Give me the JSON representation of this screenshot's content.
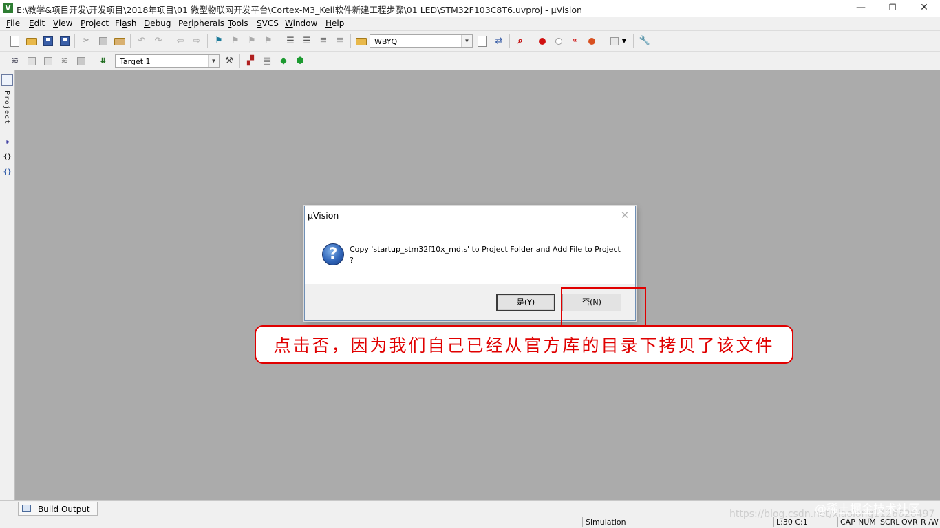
{
  "window": {
    "title": "E:\\教学&项目开发\\开发项目\\2018年项目\\01 微型物联网开发平台\\Cortex-M3_Keil软件新建工程步骤\\01 LED\\STM32F103C8T6.uvproj - µVision",
    "app_icon_letter": "V",
    "controls": {
      "minimize": "—",
      "restore": "❐",
      "close": "✕"
    }
  },
  "menu": {
    "items": [
      {
        "pre": "",
        "u": "F",
        "post": "ile"
      },
      {
        "pre": "",
        "u": "E",
        "post": "dit"
      },
      {
        "pre": "",
        "u": "V",
        "post": "iew"
      },
      {
        "pre": "",
        "u": "P",
        "post": "roject"
      },
      {
        "pre": "Fl",
        "u": "a",
        "post": "sh"
      },
      {
        "pre": "",
        "u": "D",
        "post": "ebug"
      },
      {
        "pre": "Pe",
        "u": "r",
        "post": "ipherals"
      },
      {
        "pre": "",
        "u": "T",
        "post": "ools"
      },
      {
        "pre": "",
        "u": "S",
        "post": "VCS"
      },
      {
        "pre": "",
        "u": "W",
        "post": "indow"
      },
      {
        "pre": "",
        "u": "H",
        "post": "elp"
      }
    ]
  },
  "toolbar1": {
    "find_combo_value": "WBYQ",
    "icons": [
      "new-file-icon",
      "open-folder-icon",
      "save-icon",
      "save-all-icon",
      "cut-icon",
      "copy-icon",
      "paste-icon",
      "undo-icon",
      "redo-icon",
      "nav-back-icon",
      "nav-forward-icon",
      "bookmark-icon",
      "prev-bookmark-icon",
      "next-bookmark-icon",
      "clear-bookmarks-icon",
      "indent-icon",
      "unindent-icon",
      "comment-icon",
      "uncomment-icon",
      "find-in-files-icon",
      "find-icon",
      "incremental-find-icon",
      "debug-session-icon",
      "breakpoint-icon",
      "disable-breakpoint-icon",
      "disable-all-breakpoints-icon",
      "kill-breakpoints-icon",
      "window-layout-icon",
      "configure-icon"
    ]
  },
  "toolbar2": {
    "target_combo_value": "Target 1",
    "icons": [
      "translate-icon",
      "build-icon",
      "rebuild-icon",
      "batch-build-icon",
      "stop-build-icon",
      "load-icon",
      "target-options-icon",
      "manage-components-icon",
      "pack-installer-icon",
      "select-packs-icon",
      "rte-icon"
    ]
  },
  "side_panel": {
    "project_label": "Project",
    "buttons": [
      "books-icon",
      "functions-icon",
      "templates-icon"
    ],
    "functions_glyph": "{}",
    "templates_glyph": "{}"
  },
  "bottom": {
    "build_output_tab": "Build Output"
  },
  "status": {
    "mode": "Simulation",
    "cursor": "L:30 C:1",
    "caps": "CAP",
    "num": "NUM",
    "scrl": "SCRL",
    "ovr": "OVR",
    "rw": "R /W"
  },
  "dialog": {
    "title": "µVision",
    "close_glyph": "✕",
    "icon_glyph": "?",
    "message_line1": "Copy 'startup_stm32f10x_md.s' to Project Folder and Add File to Project",
    "message_line2": "?",
    "yes_label": "是(Y)",
    "no_label": "否(N)"
  },
  "annotation": {
    "text": "点击否，因为我们自己已经从官方库的目录下拷贝了该文件",
    "color": "#e00000"
  },
  "watermark": {
    "url": "https://blog.csdn.net/xiaolong1126626497",
    "brand": "@稀土掘金技术社区"
  }
}
